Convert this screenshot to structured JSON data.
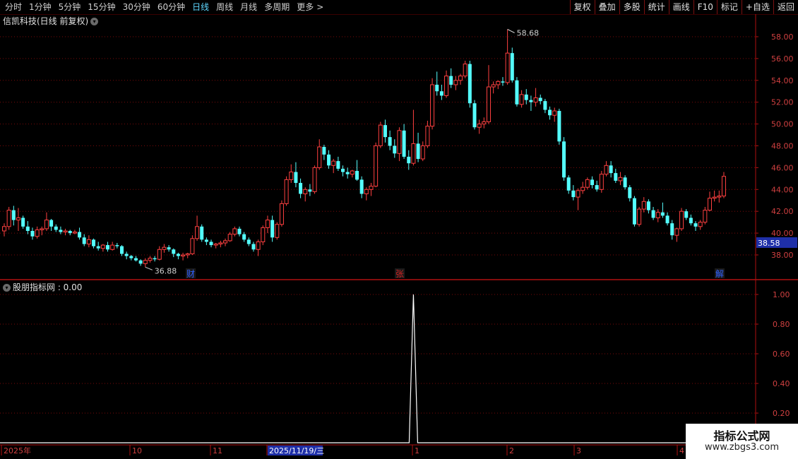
{
  "toolbar": {
    "periods": [
      "分时",
      "1分钟",
      "5分钟",
      "15分钟",
      "30分钟",
      "60分钟",
      "日线",
      "周线",
      "月线",
      "多周期",
      "更多"
    ],
    "more_arrow": ">",
    "active": "日线",
    "right_buttons": [
      "复权",
      "叠加",
      "多股",
      "统计",
      "画线",
      "F10",
      "标记",
      "+自选",
      "返回"
    ]
  },
  "main_chart": {
    "title": "信凯科技(日线 前复权)",
    "high_label": "58.68",
    "low_label": "36.88",
    "current_price": "38.58",
    "y_ticks": [
      "58.00",
      "56.00",
      "54.00",
      "52.00",
      "50.00",
      "48.00",
      "46.00",
      "44.00",
      "42.00",
      "40.00",
      "38.00"
    ],
    "markers": [
      "财",
      "张",
      "解"
    ]
  },
  "indicator": {
    "title": "股朋指标网 : 0.00",
    "y_ticks": [
      "1.00",
      "0.80",
      "0.60",
      "0.40",
      "0.20"
    ]
  },
  "x_axis": {
    "labels": [
      "2025年",
      "10",
      "11",
      "2025/11/19/三",
      "1",
      "2",
      "3",
      "4"
    ]
  },
  "watermark": {
    "line1": "指标公式网",
    "line2": "www.zbgs3.com"
  },
  "colors": {
    "up": "#ff4040",
    "down": "#54ffff",
    "grid": "#7a0a0a",
    "axis": "#b01010"
  },
  "chart_data": {
    "type": "candlestick",
    "title": "信凯科技(日线 前复权)",
    "ylim": [
      37,
      59.5
    ],
    "candles": [
      [
        40.2,
        40.9,
        39.7,
        40.6
      ],
      [
        40.6,
        42.4,
        40.3,
        42.1
      ],
      [
        42.1,
        42.5,
        40.7,
        41.2
      ],
      [
        41.2,
        42.3,
        40.2,
        41.4
      ],
      [
        41.4,
        41.6,
        40.4,
        40.6
      ],
      [
        40.6,
        41.1,
        39.9,
        40.2
      ],
      [
        40.2,
        40.5,
        39.4,
        39.7
      ],
      [
        39.7,
        40.6,
        39.5,
        40.3
      ],
      [
        40.3,
        40.6,
        39.8,
        40.4
      ],
      [
        40.4,
        41.9,
        40.2,
        41.2
      ],
      [
        41.2,
        41.3,
        40.2,
        40.6
      ],
      [
        40.6,
        40.8,
        40.1,
        40.3
      ],
      [
        40.3,
        40.6,
        39.9,
        40.1
      ],
      [
        40.1,
        40.4,
        39.8,
        40.2
      ],
      [
        40.2,
        40.3,
        39.8,
        40.0
      ],
      [
        40.0,
        40.3,
        39.9,
        40.1
      ],
      [
        40.1,
        40.5,
        39.4,
        39.6
      ],
      [
        39.6,
        39.9,
        38.8,
        39.0
      ],
      [
        39.0,
        39.8,
        38.7,
        39.4
      ],
      [
        39.4,
        39.5,
        38.6,
        38.8
      ],
      [
        38.8,
        39.2,
        38.4,
        38.6
      ],
      [
        38.6,
        39.0,
        38.3,
        38.9
      ],
      [
        38.9,
        39.2,
        38.3,
        38.5
      ],
      [
        38.5,
        39.2,
        38.4,
        38.9
      ],
      [
        38.9,
        39.1,
        38.6,
        38.8
      ],
      [
        38.8,
        38.9,
        37.9,
        38.1
      ],
      [
        38.1,
        38.3,
        37.6,
        37.9
      ],
      [
        37.9,
        38.0,
        37.5,
        37.7
      ],
      [
        37.7,
        37.9,
        37.4,
        37.5
      ],
      [
        37.5,
        37.6,
        37.0,
        37.2
      ],
      [
        37.2,
        37.7,
        36.88,
        37.5
      ],
      [
        37.5,
        37.9,
        37.3,
        37.7
      ],
      [
        37.7,
        37.9,
        37.4,
        37.6
      ],
      [
        37.6,
        38.8,
        37.5,
        38.5
      ],
      [
        38.5,
        39.0,
        38.2,
        38.7
      ],
      [
        38.7,
        38.9,
        38.3,
        38.5
      ],
      [
        38.5,
        38.6,
        37.8,
        38.1
      ],
      [
        38.1,
        38.2,
        37.6,
        37.9
      ],
      [
        37.9,
        38.2,
        37.5,
        38.0
      ],
      [
        38.0,
        38.2,
        37.7,
        38.1
      ],
      [
        38.1,
        39.8,
        38.0,
        39.5
      ],
      [
        39.5,
        41.6,
        39.3,
        40.6
      ],
      [
        40.6,
        40.8,
        39.2,
        39.4
      ],
      [
        39.4,
        39.6,
        38.9,
        39.2
      ],
      [
        39.2,
        39.4,
        38.7,
        38.9
      ],
      [
        38.9,
        39.1,
        38.6,
        39.0
      ],
      [
        39.0,
        39.3,
        38.7,
        39.1
      ],
      [
        39.1,
        39.5,
        38.8,
        39.3
      ],
      [
        39.3,
        40.1,
        39.2,
        39.9
      ],
      [
        39.9,
        40.6,
        39.7,
        40.4
      ],
      [
        40.4,
        40.6,
        39.7,
        39.9
      ],
      [
        39.9,
        40.1,
        39.2,
        39.4
      ],
      [
        39.4,
        39.6,
        38.8,
        39.0
      ],
      [
        39.0,
        39.2,
        38.3,
        38.5
      ],
      [
        38.5,
        39.4,
        37.9,
        39.2
      ],
      [
        39.2,
        40.7,
        38.9,
        40.5
      ],
      [
        40.5,
        41.6,
        40.0,
        41.2
      ],
      [
        41.2,
        41.6,
        39.2,
        39.6
      ],
      [
        39.6,
        41.0,
        39.4,
        40.8
      ],
      [
        40.8,
        43.0,
        40.6,
        42.7
      ],
      [
        42.7,
        45.2,
        42.5,
        44.9
      ],
      [
        44.9,
        46.3,
        44.6,
        45.6
      ],
      [
        45.6,
        46.5,
        44.2,
        44.6
      ],
      [
        44.6,
        45.0,
        43.2,
        43.6
      ],
      [
        43.6,
        44.2,
        42.9,
        44.0
      ],
      [
        44.0,
        44.5,
        43.4,
        43.8
      ],
      [
        43.8,
        46.2,
        43.6,
        46.0
      ],
      [
        46.0,
        48.6,
        45.8,
        47.9
      ],
      [
        47.9,
        48.1,
        46.7,
        47.2
      ],
      [
        47.2,
        47.6,
        45.9,
        46.2
      ],
      [
        46.2,
        46.8,
        45.5,
        46.6
      ],
      [
        46.6,
        47.0,
        45.7,
        45.9
      ],
      [
        45.9,
        46.2,
        45.2,
        45.6
      ],
      [
        45.6,
        46.0,
        45.0,
        45.4
      ],
      [
        45.4,
        45.8,
        45.1,
        45.7
      ],
      [
        45.7,
        46.7,
        44.8,
        44.9
      ],
      [
        44.9,
        45.2,
        43.2,
        43.6
      ],
      [
        43.6,
        44.2,
        43.0,
        44.0
      ],
      [
        44.0,
        44.6,
        43.4,
        44.3
      ],
      [
        44.3,
        48.3,
        44.2,
        48.0
      ],
      [
        48.0,
        50.2,
        47.8,
        49.9
      ],
      [
        49.9,
        50.4,
        48.3,
        48.8
      ],
      [
        48.8,
        49.4,
        47.6,
        48.0
      ],
      [
        48.0,
        48.6,
        46.9,
        47.3
      ],
      [
        47.3,
        49.7,
        46.6,
        49.4
      ],
      [
        49.4,
        50.0,
        46.8,
        47.0
      ],
      [
        47.0,
        47.6,
        45.8,
        46.4
      ],
      [
        46.4,
        51.3,
        46.2,
        48.2
      ],
      [
        48.2,
        49.2,
        46.5,
        46.8
      ],
      [
        46.8,
        48.4,
        46.6,
        48.0
      ],
      [
        48.0,
        50.3,
        47.8,
        49.8
      ],
      [
        49.8,
        54.2,
        49.5,
        53.6
      ],
      [
        53.6,
        54.8,
        52.6,
        53.0
      ],
      [
        53.0,
        53.6,
        52.2,
        52.6
      ],
      [
        52.6,
        54.9,
        52.4,
        54.4
      ],
      [
        54.4,
        55.1,
        53.3,
        53.6
      ],
      [
        53.6,
        54.4,
        53.1,
        54.0
      ],
      [
        54.0,
        54.6,
        53.6,
        54.4
      ],
      [
        54.4,
        55.8,
        54.2,
        55.5
      ],
      [
        55.5,
        55.8,
        51.5,
        51.9
      ],
      [
        51.9,
        52.2,
        49.5,
        49.7
      ],
      [
        49.7,
        50.4,
        49.1,
        50.0
      ],
      [
        50.0,
        50.6,
        49.6,
        50.2
      ],
      [
        50.2,
        55.4,
        50.0,
        53.4
      ],
      [
        53.4,
        53.9,
        52.8,
        53.6
      ],
      [
        53.6,
        54.0,
        53.2,
        53.9
      ],
      [
        53.9,
        54.3,
        53.5,
        53.8
      ],
      [
        53.8,
        58.68,
        53.6,
        56.5
      ],
      [
        56.5,
        57.0,
        53.8,
        54.0
      ],
      [
        54.0,
        54.3,
        51.6,
        51.8
      ],
      [
        51.8,
        53.1,
        51.5,
        52.7
      ],
      [
        52.7,
        53.2,
        51.8,
        52.2
      ],
      [
        52.2,
        52.6,
        51.2,
        52.0
      ],
      [
        52.0,
        53.3,
        51.6,
        52.4
      ],
      [
        52.4,
        52.7,
        51.8,
        52.1
      ],
      [
        52.1,
        52.3,
        51.0,
        51.3
      ],
      [
        51.3,
        51.6,
        50.4,
        50.8
      ],
      [
        50.8,
        51.5,
        50.2,
        51.2
      ],
      [
        51.2,
        51.4,
        48.1,
        48.4
      ],
      [
        48.4,
        48.8,
        44.8,
        45.1
      ],
      [
        45.1,
        45.3,
        43.6,
        43.9
      ],
      [
        43.9,
        44.4,
        43.0,
        43.3
      ],
      [
        43.3,
        44.1,
        42.1,
        43.9
      ],
      [
        43.9,
        44.7,
        43.6,
        44.2
      ],
      [
        44.2,
        45.1,
        44.0,
        44.9
      ],
      [
        44.9,
        45.2,
        44.1,
        44.4
      ],
      [
        44.4,
        44.8,
        43.8,
        44.0
      ],
      [
        44.0,
        45.7,
        43.7,
        45.4
      ],
      [
        45.4,
        46.6,
        45.2,
        46.2
      ],
      [
        46.2,
        46.6,
        45.1,
        45.5
      ],
      [
        45.5,
        45.9,
        44.6,
        44.8
      ],
      [
        44.8,
        45.6,
        44.4,
        45.1
      ],
      [
        45.1,
        45.3,
        44.0,
        44.2
      ],
      [
        44.2,
        44.4,
        42.9,
        43.2
      ],
      [
        43.2,
        43.4,
        40.6,
        40.8
      ],
      [
        40.8,
        42.4,
        40.6,
        42.2
      ],
      [
        42.2,
        43.3,
        41.9,
        42.9
      ],
      [
        42.9,
        43.1,
        41.8,
        42.1
      ],
      [
        42.1,
        42.4,
        41.2,
        41.4
      ],
      [
        41.4,
        42.2,
        41.0,
        41.9
      ],
      [
        41.9,
        42.8,
        41.4,
        41.6
      ],
      [
        41.6,
        41.9,
        40.7,
        40.9
      ],
      [
        40.9,
        41.2,
        39.4,
        39.8
      ],
      [
        39.8,
        40.5,
        39.2,
        40.4
      ],
      [
        40.4,
        42.3,
        40.2,
        42.0
      ],
      [
        42.0,
        42.2,
        41.2,
        41.4
      ],
      [
        41.4,
        41.7,
        40.7,
        40.9
      ],
      [
        40.9,
        41.1,
        40.2,
        40.6
      ],
      [
        40.6,
        41.2,
        40.3,
        41.0
      ],
      [
        41.0,
        42.4,
        40.8,
        42.1
      ],
      [
        42.1,
        43.8,
        42.0,
        43.2
      ],
      [
        43.2,
        43.9,
        42.9,
        43.3
      ],
      [
        43.3,
        43.9,
        42.8,
        43.4
      ],
      [
        43.4,
        45.6,
        43.2,
        45.2
      ]
    ],
    "indicator_line": {
      "ylim": [
        0,
        1.1
      ],
      "spike_index": 87,
      "values_note_hidden": true
    }
  }
}
